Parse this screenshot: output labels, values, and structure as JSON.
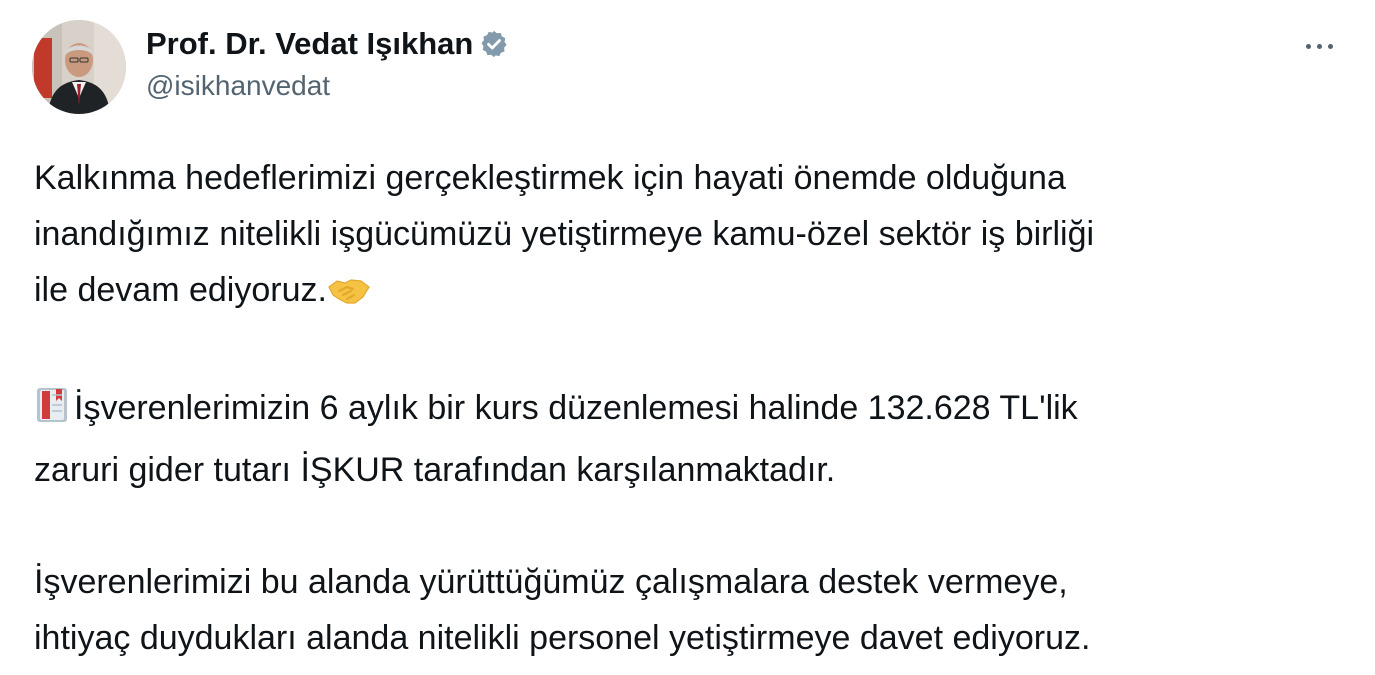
{
  "author": {
    "display_name": "Prof. Dr. Vedat Işıkhan",
    "handle": "@isikhanvedat",
    "verified": true,
    "avatar_icon": "portrait-avatar",
    "verified_icon": "verified-badge-icon",
    "more_icon": "more-options-icon"
  },
  "tweet": {
    "para1": {
      "line1": "Kalkınma hedeflerimizi gerçekleştirmek için hayati önemde olduğuna",
      "line2": "inandığımız nitelikli işgücümüzü yetiştirmeye kamu-özel sektör iş birliği",
      "line3": "ile devam ediyoruz.",
      "emoji": "handshake-emoji"
    },
    "para2": {
      "emoji": "book-emoji",
      "line1": "İşverenlerimizin 6 aylık bir kurs düzenlemesi halinde 132.628 TL'lik",
      "line2": "zaruri gider tutarı İŞKUR tarafından karşılanmaktadır."
    },
    "para3": {
      "line1": "İşverenlerimizi bu alanda yürüttüğümüz çalışmalara destek vermeye,",
      "line2": "ihtiyaç duydukları alanda nitelikli personel yetiştirmeye davet ediyoruz."
    }
  },
  "colors": {
    "text": "#0f1419",
    "secondary": "#536471",
    "verified_badge": "#829aab",
    "background": "#ffffff"
  }
}
